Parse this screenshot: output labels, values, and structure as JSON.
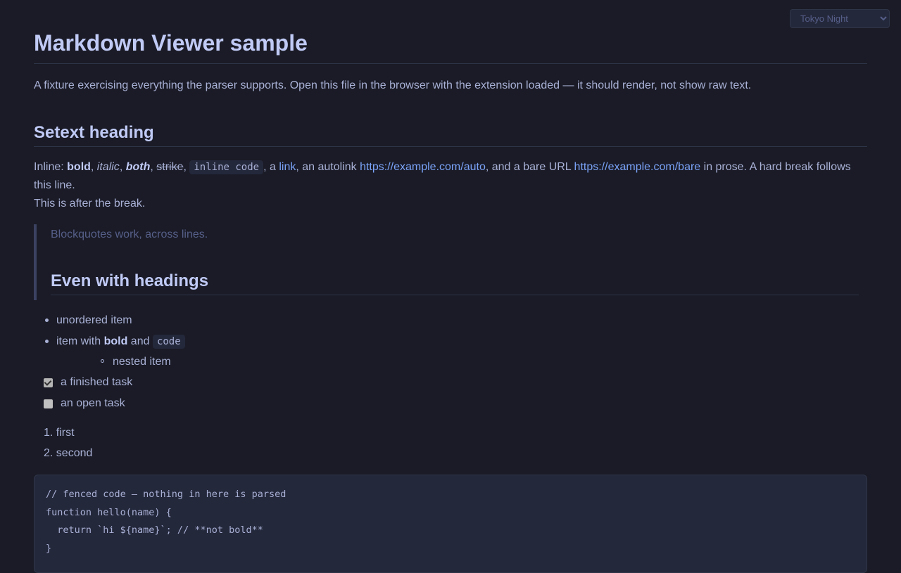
{
  "theme_select": {
    "selected": "Tokyo Night"
  },
  "doc": {
    "title": "Markdown Viewer sample",
    "intro": "A fixture exercising everything the parser supports. Open this file in the browser with the extension loaded — it should render, not show raw text.",
    "setext_heading": "Setext heading",
    "inline": {
      "prefix": "Inline: ",
      "bold": "bold",
      "sep1": ", ",
      "italic": "italic",
      "sep2": ", ",
      "both": "both",
      "sep3": ", ",
      "strike": "strike",
      "sep4": ", ",
      "code": "inline code",
      "sep5": ", a ",
      "link": "link",
      "sep6": ", an autolink ",
      "autolink": "https://example.com/auto",
      "sep7": ", and a bare URL ",
      "bare_url": "https://example.com/bare",
      "suffix": " in prose. A hard break follows this line."
    },
    "after_break": "This is after the break.",
    "blockquote": {
      "text": "Blockquotes work, across lines.",
      "heading": "Even with headings"
    },
    "list": {
      "item1": "unordered item",
      "item2_prefix": "item with ",
      "item2_bold": "bold",
      "item2_mid": " and ",
      "item2_code": "code",
      "nested": "nested item"
    },
    "tasks": [
      {
        "label": "a finished task",
        "checked": true
      },
      {
        "label": "an open task",
        "checked": false
      }
    ],
    "ordered": [
      "1. first",
      "2. second"
    ],
    "code_lines": [
      "// fenced code — nothing in here is parsed",
      "function hello(name) {",
      "  return `hi ${name}`; // **not bold**",
      "}"
    ]
  }
}
